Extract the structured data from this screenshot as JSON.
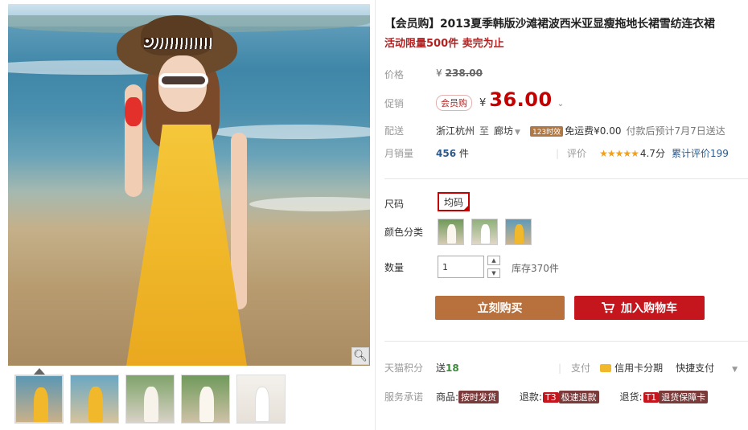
{
  "gallery": {
    "main_image_alt": "",
    "thumbs": [
      {
        "id": "t1",
        "active": true
      },
      {
        "id": "t2",
        "active": false
      },
      {
        "id": "t3",
        "active": false
      },
      {
        "id": "t4",
        "active": false
      },
      {
        "id": "t5",
        "active": false
      }
    ],
    "zoom_icon": "magnifier-icon"
  },
  "product": {
    "title": "【会员购】2013夏季韩版沙滩裙波西米亚显瘦拖地长裙雪纺连衣裙",
    "subtitle": "活动限量500件 卖完为止"
  },
  "price": {
    "orig_label": "价格",
    "currency": "¥",
    "orig_value": "238.00",
    "promo_label": "促销",
    "vip_badge": "会员购",
    "promo_value": "36.00",
    "promo_dropdown_icon": "chevron-down-icon"
  },
  "shipping": {
    "label": "配送",
    "from": "浙江杭州",
    "to_word": "至",
    "dest": "廊坊",
    "timing_tag": "123时效",
    "fee": "免运费¥0.00",
    "eta": "付款后预计7月7日送达"
  },
  "sales": {
    "label": "月销量",
    "count": "456",
    "unit": "件",
    "rating_label": "评价",
    "stars": "★★★★★",
    "score": "4.7分",
    "review_count": "累计评价199"
  },
  "options": {
    "size_label": "尺码",
    "size_value": "均码",
    "color_label": "颜色分类",
    "colors": [
      {
        "id": "white-1"
      },
      {
        "id": "white-2"
      },
      {
        "id": "yellow"
      }
    ],
    "qty_label": "数量",
    "qty_value": "1",
    "stock": "库存370件"
  },
  "actions": {
    "buy_now": "立刻购买",
    "add_cart": "加入购物车"
  },
  "extras": {
    "points_label": "天猫积分",
    "points_text": "送",
    "points_value": "18",
    "pay_label": "支付",
    "installment": "信用卡分期",
    "quick_pay": "快捷支付",
    "service_label": "服务承诺",
    "service_items": [
      {
        "prefix": "商品:",
        "tag": "按时发货"
      },
      {
        "prefix": "退款:",
        "tag_letter": "T3",
        "tag": "极速退款"
      },
      {
        "prefix": "退货:",
        "tag_letter": "T1",
        "tag": "退货保障卡"
      }
    ]
  },
  "colors": {
    "accent_red": "#c40000",
    "buy_brown": "#b8703d",
    "cart_red": "#c5161d",
    "link_blue": "#2b5a8e"
  }
}
